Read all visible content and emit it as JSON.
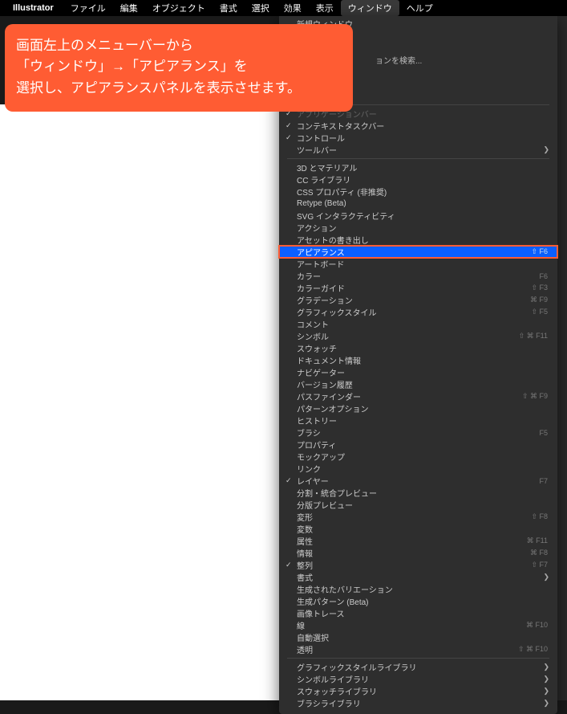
{
  "menubar": {
    "app": "Illustrator",
    "items": [
      "ファイル",
      "編集",
      "オブジェクト",
      "書式",
      "選択",
      "効果",
      "表示",
      "ウィンドウ",
      "ヘルプ"
    ]
  },
  "callout": {
    "line1": "画面左上のメニューバーから",
    "line2": "「ウィンドウ」→「アピアランス」を",
    "line3": "選択し、アピアランスパネルを表示させます。"
  },
  "hidden": "ョンを検索...",
  "menu": {
    "newWindow": "新規ウィンドウ",
    "appBar": "アプリケーションバー",
    "contextBar": "コンテキストタスクバー",
    "control": "コントロール",
    "toolbar": "ツールバー",
    "threeD": "3D とマテリアル",
    "cc": "CC ライブラリ",
    "css": "CSS プロパティ (非推奨)",
    "retype": "Retype (Beta)",
    "svg": "SVG インタラクティビティ",
    "action": "アクション",
    "asset": "アセットの書き出し",
    "appearance": "アピアランス",
    "appearanceKey": "⇧ F6",
    "artboard": "アートボード",
    "color": "カラー",
    "colorKey": "F6",
    "colorGuide": "カラーガイド",
    "colorGuideKey": "⇧ F3",
    "gradient": "グラデーション",
    "gradientKey": "⌘ F9",
    "graphicStyle": "グラフィックスタイル",
    "graphicStyleKey": "⇧ F5",
    "comment": "コメント",
    "symbol": "シンボル",
    "symbolKey": "⇧ ⌘ F11",
    "swatch": "スウォッチ",
    "docInfo": "ドキュメント情報",
    "navigator": "ナビゲーター",
    "versionHistory": "バージョン履歴",
    "pathfinder": "パスファインダー",
    "pathfinderKey": "⇧ ⌘ F9",
    "patternOption": "パターンオプション",
    "history": "ヒストリー",
    "brush": "ブラシ",
    "brushKey": "F5",
    "property": "プロパティ",
    "mockup": "モックアップ",
    "link": "リンク",
    "layer": "レイヤー",
    "layerKey": "F7",
    "separation": "分割・統合プレビュー",
    "sepPreview": "分版プレビュー",
    "transform": "変形",
    "transformKey": "⇧ F8",
    "variable": "変数",
    "attribute": "属性",
    "attributeKey": "⌘ F11",
    "info": "情報",
    "infoKey": "⌘ F8",
    "align": "整列",
    "alignKey": "⇧ F7",
    "paragraph": "書式",
    "genVariation": "生成されたバリエーション",
    "genPattern": "生成パターン (Beta)",
    "imageTrace": "画像トレース",
    "stroke": "線",
    "strokeKey": "⌘ F10",
    "autoSelect": "自動選択",
    "transparency": "透明",
    "transparencyKey": "⇧ ⌘ F10",
    "graphicStyleLib": "グラフィックスタイルライブラリ",
    "symbolLib": "シンボルライブラリ",
    "swatchLib": "スウォッチライブラリ",
    "brushLib": "ブラシライブラリ"
  }
}
